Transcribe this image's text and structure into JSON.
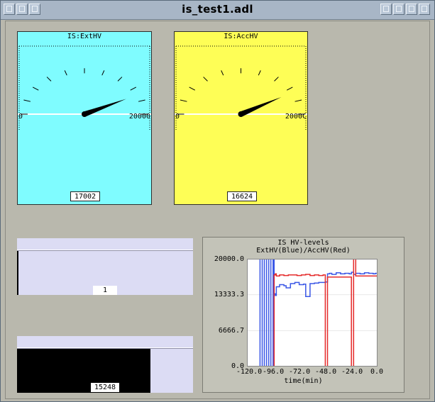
{
  "window": {
    "title": "is_test1.adl"
  },
  "meters": [
    {
      "label": "IS:ExtHV",
      "min_label": "0",
      "max_label": "20000",
      "readout": "17002",
      "value": 17002,
      "max": 20000,
      "bg": "#7ffcff"
    },
    {
      "label": "IS:AccHV",
      "min_label": "0",
      "max_label": "2000C",
      "readout": "16624",
      "value": 16624,
      "max": 20000,
      "bg": "#fefe56"
    }
  ],
  "bars": [
    {
      "value_text": "1",
      "fraction": 0.01
    },
    {
      "value_text": "15248",
      "fraction": 0.76
    }
  ],
  "chart_data": {
    "type": "line",
    "title": "IS HV-levels",
    "subtitle": "ExtHV(Blue)/AccHV(Red)",
    "xlabel": "time(min)",
    "y_tick_labels": [
      "20000.0",
      "13333.3",
      "6666.7",
      "0.0"
    ],
    "x_tick_labels": [
      "-120.0",
      "-96.0",
      "-72.0",
      "-48.0",
      "-24.0",
      "0.0"
    ],
    "xlim": [
      -120,
      0
    ],
    "ylim": [
      0,
      20000
    ],
    "series": [
      {
        "color": "#3a57e6",
        "x": [
          -110,
          -108,
          -106,
          -104,
          -102,
          -100,
          -98,
          -96,
          -95,
          -94,
          -93,
          -90,
          -86,
          -84,
          -80,
          -76,
          -72,
          -68,
          -66,
          -62,
          -58,
          -54,
          -50,
          -48,
          -46,
          -44,
          -42,
          -38,
          -34,
          -30,
          -26,
          -24,
          -22,
          -20,
          -16,
          -12,
          -8,
          -4,
          -2,
          0
        ],
        "y": [
          0,
          20000,
          0,
          20000,
          0,
          20000,
          0,
          20000,
          13500,
          13200,
          14800,
          15200,
          15000,
          14600,
          15400,
          15600,
          15200,
          15300,
          13000,
          15400,
          15500,
          15600,
          15600,
          15700,
          17200,
          17300,
          17100,
          17400,
          17200,
          17300,
          17200,
          17500,
          17100,
          17300,
          17200,
          17400,
          17300,
          17200,
          17300,
          17400
        ]
      },
      {
        "color": "#e52b2b",
        "x": [
          -120,
          -100,
          -99,
          -96,
          -95,
          -94,
          -93,
          -90,
          -86,
          -82,
          -78,
          -74,
          -70,
          -66,
          -62,
          -58,
          -54,
          -50,
          -49,
          -48,
          -46,
          -42,
          -38,
          -34,
          -30,
          -26,
          -25,
          -24,
          -22,
          -20,
          -18,
          -14,
          -10,
          -6,
          -2,
          0
        ],
        "y": [
          0,
          0,
          0,
          0,
          17000,
          17200,
          16800,
          17000,
          16900,
          17000,
          17000,
          16900,
          17000,
          17100,
          16900,
          17000,
          16900,
          17000,
          17000,
          0,
          16600,
          16600,
          16600,
          16600,
          16600,
          16600,
          16600,
          0,
          20000,
          16800,
          16800,
          16800,
          16800,
          16800,
          16800,
          16800
        ]
      }
    ]
  }
}
